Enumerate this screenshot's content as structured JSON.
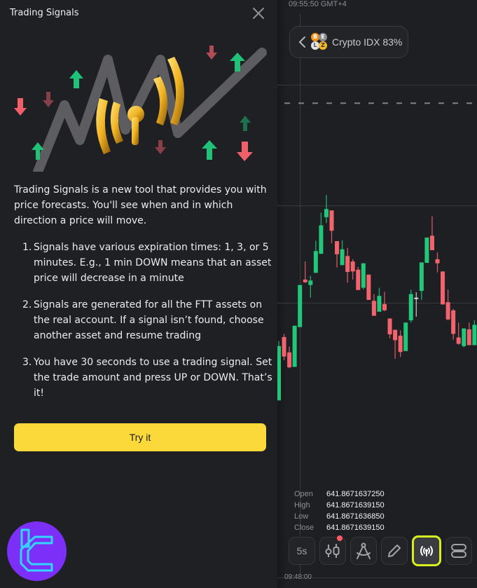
{
  "panel": {
    "title": "Trading Signals",
    "intro": "Trading Signals is a new tool that provides you with price forecasts. You'll see when and in which direction a price will move.",
    "steps": [
      {
        "num": "1.",
        "text": "Signals have various expiration times: 1, 3, or 5 minutes. E.g., 1 min DOWN means that an asset price will decrease in a minute"
      },
      {
        "num": "2.",
        "text": "Signals are generated for all the FTT assets on the real account. If a signal isn’t found, choose another asset and resume trading"
      },
      {
        "num": "3.",
        "text": "You have 30 seconds to use a trading signal. Set the trade amount and press UP or DOWN. That’s it!"
      }
    ],
    "try_button": "Try it",
    "close_icon": "close-icon"
  },
  "chart": {
    "time_top": "09:55:50 GMT+4",
    "time_bottom": "09:48:00",
    "asset": {
      "name": "Crypto IDX 83%",
      "icons": [
        "B",
        "E",
        "L",
        "Z"
      ]
    },
    "ohlc": [
      {
        "label": "Open",
        "value": "641.8671637250"
      },
      {
        "label": "High",
        "value": "641.8671639150"
      },
      {
        "label": "Low",
        "value": "641.8671636850"
      },
      {
        "label": "Close",
        "value": "641.8671639150"
      }
    ],
    "toolbar": [
      {
        "id": "timeframe",
        "label": "5s",
        "icon": "timeframe"
      },
      {
        "id": "chart-type",
        "label": "",
        "icon": "candlestick-icon",
        "badge": true
      },
      {
        "id": "indicators",
        "label": "",
        "icon": "compass-icon"
      },
      {
        "id": "drawing",
        "label": "",
        "icon": "pencil-icon"
      },
      {
        "id": "signals",
        "label": "",
        "icon": "signal-broadcast-icon",
        "active": true
      },
      {
        "id": "layout",
        "label": "",
        "icon": "layout-rows-icon"
      }
    ],
    "colors": {
      "up": "#22c77a",
      "down": "#f2646d",
      "accent": "#fcd93a",
      "highlight": "#d6f01e"
    }
  },
  "chart_data": {
    "type": "candlestick",
    "title": "Crypto IDX",
    "xlabel": "",
    "ylabel": "",
    "price_line": 151.0,
    "ylim": [
      70,
      200
    ],
    "grid_levels": [
      155.0,
      128.3,
      106.8
    ],
    "candles": [
      {
        "o": 85.3,
        "c": 97.3,
        "h": 98.4,
        "l": 85.3
      },
      {
        "o": 99.3,
        "c": 95.0,
        "h": 100.0,
        "l": 94.2
      },
      {
        "o": 95.9,
        "c": 92.6,
        "h": 97.2,
        "l": 92.4
      },
      {
        "o": 92.7,
        "c": 101.8,
        "h": 101.8,
        "l": 92.7
      },
      {
        "o": 101.5,
        "c": 110.8,
        "h": 110.8,
        "l": 101.5
      },
      {
        "o": 112.0,
        "c": 111.4,
        "h": 116.0,
        "l": 111.3
      },
      {
        "o": 110.8,
        "c": 111.8,
        "h": 112.8,
        "l": 108.0
      },
      {
        "o": 113.5,
        "c": 118.3,
        "h": 120.6,
        "l": 113.5
      },
      {
        "o": 117.7,
        "c": 124.0,
        "h": 126.8,
        "l": 117.7
      },
      {
        "o": 125.8,
        "c": 127.6,
        "h": 130.7,
        "l": 124.5
      },
      {
        "o": 127.3,
        "c": 122.8,
        "h": 127.3,
        "l": 120.0
      },
      {
        "o": 120.5,
        "c": 117.6,
        "h": 120.5,
        "l": 114.7
      },
      {
        "o": 115.2,
        "c": 118.7,
        "h": 120.7,
        "l": 115.2
      },
      {
        "o": 117.2,
        "c": 113.7,
        "h": 119.0,
        "l": 111.3
      },
      {
        "o": 116.0,
        "c": 113.8,
        "h": 116.5,
        "l": 112.0
      },
      {
        "o": 114.2,
        "c": 109.7,
        "h": 114.8,
        "l": 109.7
      },
      {
        "o": 110.2,
        "c": 115.6,
        "h": 115.6,
        "l": 109.8
      },
      {
        "o": 113.1,
        "c": 107.5,
        "h": 113.1,
        "l": 107.5
      },
      {
        "o": 107.3,
        "c": 104.0,
        "h": 108.8,
        "l": 104.0
      },
      {
        "o": 104.9,
        "c": 108.4,
        "h": 110.2,
        "l": 104.9
      },
      {
        "o": 106.6,
        "c": 105.2,
        "h": 109.3,
        "l": 105.0
      },
      {
        "o": 103.4,
        "c": 99.9,
        "h": 103.4,
        "l": 99.0
      },
      {
        "o": 100.9,
        "c": 98.6,
        "h": 100.9,
        "l": 94.5
      },
      {
        "o": 99.6,
        "c": 96.0,
        "h": 100.8,
        "l": 94.9
      },
      {
        "o": 96.2,
        "c": 102.5,
        "h": 102.5,
        "l": 96.2
      },
      {
        "o": 103.0,
        "c": 108.8,
        "h": 109.8,
        "l": 102.5
      },
      {
        "o": 108.0,
        "c": 108.0,
        "h": 109.2,
        "l": 103.8
      },
      {
        "o": 109.5,
        "c": 115.8,
        "h": 115.8,
        "l": 107.5
      },
      {
        "o": 115.7,
        "c": 121.3,
        "h": 121.3,
        "l": 115.7
      },
      {
        "o": 121.7,
        "c": 118.5,
        "h": 126.0,
        "l": 118.5
      },
      {
        "o": 116.5,
        "c": 115.6,
        "h": 118.0,
        "l": 113.6
      },
      {
        "o": 113.8,
        "c": 106.5,
        "h": 113.8,
        "l": 106.5
      },
      {
        "o": 107.0,
        "c": 103.2,
        "h": 109.8,
        "l": 103.0
      },
      {
        "o": 105.2,
        "c": 100.0,
        "h": 105.5,
        "l": 98.7
      },
      {
        "o": 99.2,
        "c": 97.8,
        "h": 102.5,
        "l": 97.6
      },
      {
        "o": 97.3,
        "c": 101.2,
        "h": 101.2,
        "l": 97.0
      },
      {
        "o": 101.0,
        "c": 97.5,
        "h": 102.5,
        "l": 97.5
      },
      {
        "o": 97.5,
        "c": 102.0,
        "h": 103.0,
        "l": 97.5
      }
    ]
  }
}
